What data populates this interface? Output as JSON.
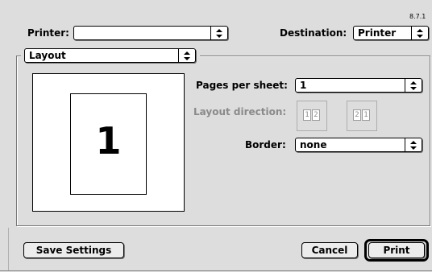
{
  "version": "8.7.1",
  "printer": {
    "label": "Printer:",
    "value": ""
  },
  "destination": {
    "label": "Destination:",
    "value": "Printer"
  },
  "panel": {
    "value": "Layout"
  },
  "preview": {
    "page_number": "1"
  },
  "pages_per_sheet": {
    "label": "Pages per sheet:",
    "value": "1"
  },
  "layout_direction": {
    "label": "Layout direction:",
    "option_ltr": {
      "left": "1",
      "right": "2"
    },
    "option_rtl": {
      "left": "2",
      "right": "1"
    }
  },
  "border": {
    "label": "Border:",
    "value": "none"
  },
  "buttons": {
    "save_settings": "Save Settings",
    "cancel": "Cancel",
    "print": "Print"
  },
  "colors": {
    "background": "#dddddd",
    "disabled_text": "#8a8a8a"
  },
  "icons": {
    "popup_arrow": "up-down-arrows-icon"
  }
}
